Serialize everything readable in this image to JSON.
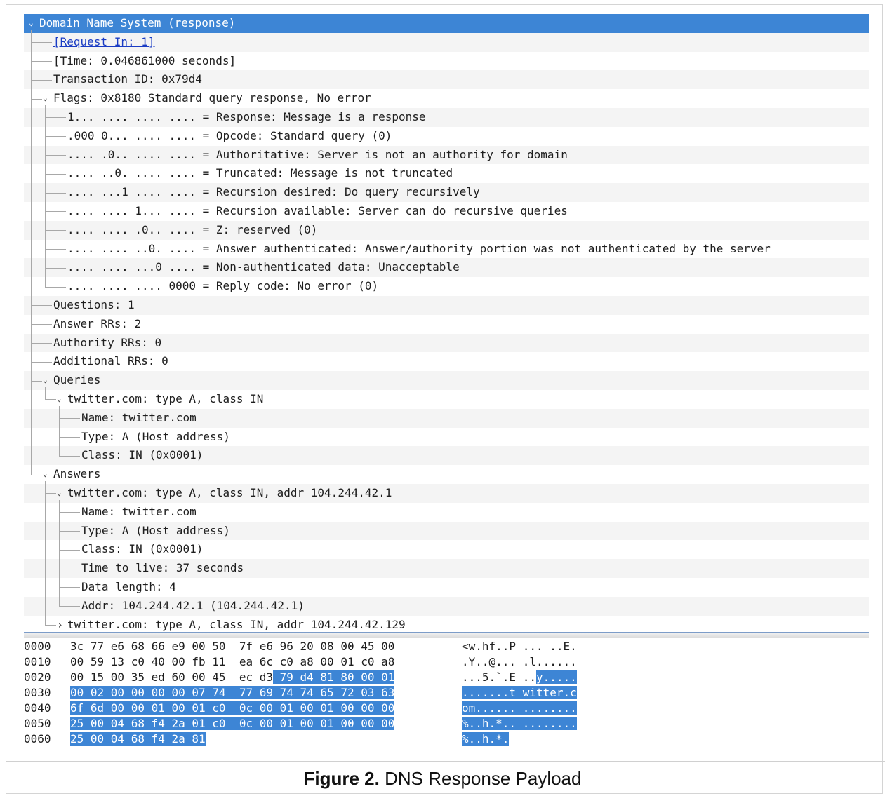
{
  "tree": [
    {
      "depth": 0,
      "arrow": "expanded",
      "text": "Domain Name System (response)",
      "selected": true
    },
    {
      "depth": 1,
      "arrow": "none",
      "text": "[Request In: 1]",
      "link": true
    },
    {
      "depth": 1,
      "arrow": "none",
      "text": "[Time: 0.046861000 seconds]"
    },
    {
      "depth": 1,
      "arrow": "none",
      "text": "Transaction ID: 0x79d4"
    },
    {
      "depth": 1,
      "arrow": "expanded",
      "text": "Flags: 0x8180 Standard query response, No error"
    },
    {
      "depth": 2,
      "arrow": "none",
      "text": "1... .... .... .... = Response: Message is a response"
    },
    {
      "depth": 2,
      "arrow": "none",
      "text": ".000 0... .... .... = Opcode: Standard query (0)"
    },
    {
      "depth": 2,
      "arrow": "none",
      "text": ".... .0.. .... .... = Authoritative: Server is not an authority for domain"
    },
    {
      "depth": 2,
      "arrow": "none",
      "text": ".... ..0. .... .... = Truncated: Message is not truncated"
    },
    {
      "depth": 2,
      "arrow": "none",
      "text": ".... ...1 .... .... = Recursion desired: Do query recursively"
    },
    {
      "depth": 2,
      "arrow": "none",
      "text": ".... .... 1... .... = Recursion available: Server can do recursive queries"
    },
    {
      "depth": 2,
      "arrow": "none",
      "text": ".... .... .0.. .... = Z: reserved (0)"
    },
    {
      "depth": 2,
      "arrow": "none",
      "text": ".... .... ..0. .... = Answer authenticated: Answer/authority portion was not authenticated by the server"
    },
    {
      "depth": 2,
      "arrow": "none",
      "text": ".... .... ...0 .... = Non-authenticated data: Unacceptable"
    },
    {
      "depth": 2,
      "arrow": "none",
      "text": ".... .... .... 0000 = Reply code: No error (0)"
    },
    {
      "depth": 1,
      "arrow": "none",
      "text": "Questions: 1"
    },
    {
      "depth": 1,
      "arrow": "none",
      "text": "Answer RRs: 2"
    },
    {
      "depth": 1,
      "arrow": "none",
      "text": "Authority RRs: 0"
    },
    {
      "depth": 1,
      "arrow": "none",
      "text": "Additional RRs: 0"
    },
    {
      "depth": 1,
      "arrow": "expanded",
      "text": "Queries"
    },
    {
      "depth": 2,
      "arrow": "expanded",
      "text": "twitter.com: type A, class IN"
    },
    {
      "depth": 3,
      "arrow": "none",
      "text": "Name: twitter.com"
    },
    {
      "depth": 3,
      "arrow": "none",
      "text": "Type: A (Host address)"
    },
    {
      "depth": 3,
      "arrow": "none",
      "text": "Class: IN (0x0001)"
    },
    {
      "depth": 1,
      "arrow": "expanded",
      "text": "Answers"
    },
    {
      "depth": 2,
      "arrow": "expanded",
      "text": "twitter.com: type A, class IN, addr 104.244.42.1"
    },
    {
      "depth": 3,
      "arrow": "none",
      "text": "Name: twitter.com"
    },
    {
      "depth": 3,
      "arrow": "none",
      "text": "Type: A (Host address)"
    },
    {
      "depth": 3,
      "arrow": "none",
      "text": "Class: IN (0x0001)"
    },
    {
      "depth": 3,
      "arrow": "none",
      "text": "Time to live: 37 seconds"
    },
    {
      "depth": 3,
      "arrow": "none",
      "text": "Data length: 4"
    },
    {
      "depth": 3,
      "arrow": "none",
      "text": "Addr: 104.244.42.1 (104.244.42.1)"
    },
    {
      "depth": 2,
      "arrow": "collapsed",
      "text": "twitter.com: type A, class IN, addr 104.244.42.129"
    }
  ],
  "hex": [
    {
      "offset": "0000",
      "bytes": "3c 77 e6 68 66 e9 00 50  7f e6 96 20 08 00 45 00",
      "ascii": "<w.hf..P ... ..E.",
      "hl_bytes_from": -1,
      "hl_ascii_from": -1
    },
    {
      "offset": "0010",
      "bytes": "00 59 13 c0 40 00 fb 11  ea 6c c0 a8 00 01 c0 a8",
      "ascii": ".Y..@... .l......",
      "hl_bytes_from": -1,
      "hl_ascii_from": -1
    },
    {
      "offset": "0020",
      "bytes": "00 15 00 35 ed 60 00 45  ec d3 79 d4 81 80 00 01",
      "ascii": "...5.`.E ..y.....",
      "hl_bytes_from": 30,
      "hl_ascii_from": 11
    },
    {
      "offset": "0030",
      "bytes": "00 02 00 00 00 00 07 74  77 69 74 74 65 72 03 63",
      "ascii": ".......t witter.c",
      "hl_bytes_from": 0,
      "hl_ascii_from": 0
    },
    {
      "offset": "0040",
      "bytes": "6f 6d 00 00 01 00 01 c0  0c 00 01 00 01 00 00 00",
      "ascii": "om...... ........",
      "hl_bytes_from": 0,
      "hl_ascii_from": 0
    },
    {
      "offset": "0050",
      "bytes": "25 00 04 68 f4 2a 01 c0  0c 00 01 00 01 00 00 00",
      "ascii": "%..h.*.. ........",
      "hl_bytes_from": 0,
      "hl_ascii_from": 0
    },
    {
      "offset": "0060",
      "bytes": "25 00 04 68 f4 2a 81",
      "ascii": "%..h.*.",
      "hl_bytes_from": 0,
      "hl_ascii_from": 0
    }
  ],
  "caption": {
    "bold": "Figure 2.",
    "text": " DNS Response Payload"
  },
  "colors": {
    "selection": "#3d85d5",
    "link": "#1a3cc4"
  }
}
